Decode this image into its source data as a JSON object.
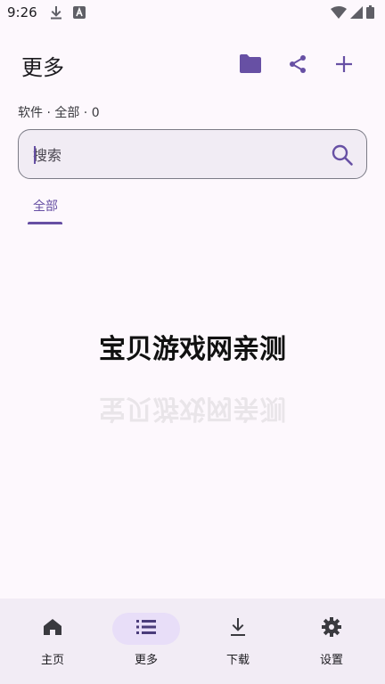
{
  "status_bar": {
    "time": "9:26"
  },
  "header": {
    "title": "更多"
  },
  "subtitle": "软件 · 全部 · 0",
  "search": {
    "placeholder": "搜索"
  },
  "tabs": [
    {
      "label": "全部"
    }
  ],
  "watermark": "宝贝游戏网亲测",
  "bottom_nav": {
    "items": [
      {
        "label": "主页",
        "icon": "home-icon"
      },
      {
        "label": "更多",
        "icon": "list-icon"
      },
      {
        "label": "下载",
        "icon": "download-icon"
      },
      {
        "label": "设置",
        "icon": "gear-icon"
      }
    ],
    "active_index": 1
  },
  "colors": {
    "accent": "#6750a4",
    "background": "#fdf8fd",
    "nav_background": "#f2ecf5",
    "active_pill": "#e8def8"
  }
}
